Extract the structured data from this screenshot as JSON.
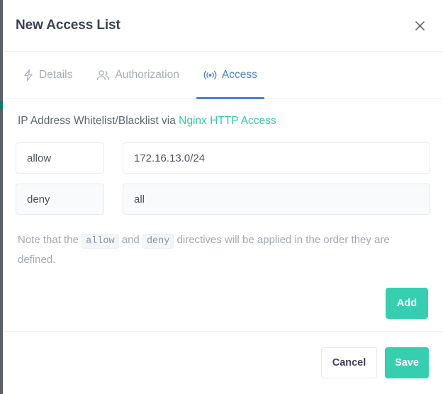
{
  "modal": {
    "title": "New Access List",
    "close_icon": "close-icon"
  },
  "tabs": [
    {
      "label": "Details",
      "icon": "lightning-bolt-icon",
      "active": false
    },
    {
      "label": "Authorization",
      "icon": "users-icon",
      "active": false
    },
    {
      "label": "Access",
      "icon": "broadcast-icon",
      "active": true
    }
  ],
  "body": {
    "lead_text": "IP Address Whitelist/Blacklist via ",
    "lead_link": "Nginx HTTP Access",
    "rules": [
      {
        "directive": "allow",
        "directive_placeholder": "allow",
        "target": "172.16.13.0/24",
        "target_placeholder": "",
        "muted": false
      },
      {
        "directive": "deny",
        "directive_placeholder": "deny",
        "target": "all",
        "target_placeholder": "",
        "muted": true
      }
    ],
    "note_part_1": "Note that the ",
    "note_code_1": "allow",
    "note_part_2": " and ",
    "note_code_2": "deny",
    "note_part_3": " directives will be applied in the order they are defined.",
    "add_label": "Add"
  },
  "footer": {
    "cancel_label": "Cancel",
    "save_label": "Save"
  },
  "colors": {
    "accent_teal": "#35cfb0",
    "tab_active_blue": "#4a7fd4",
    "link_teal": "#33c9a9",
    "title_text": "#3c4257",
    "muted_text": "#a2a8b4",
    "border": "#e6e9ef",
    "sidebar_dark": "#5b5f66",
    "sidebar_active": "#0e7c6b"
  }
}
